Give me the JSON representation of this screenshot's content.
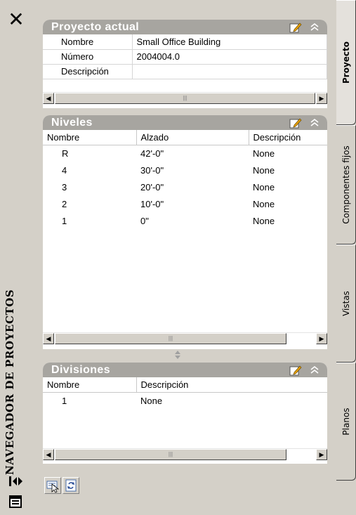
{
  "strip": {
    "title": "NAVEGADOR DE PROYECTOS",
    "close_icon": "close-icon",
    "auto_hide_icon": "auto-hide-icon",
    "properties_icon": "properties-icon"
  },
  "proyecto": {
    "title": "Proyecto actual",
    "rows": [
      {
        "label": "Nombre",
        "value": "Small Office Building"
      },
      {
        "label": "Número",
        "value": "2004004.0"
      },
      {
        "label": "Descripción",
        "value": ""
      }
    ]
  },
  "niveles": {
    "title": "Niveles",
    "columns": [
      "Nombre",
      "Alzado",
      "Descripción"
    ],
    "rows": [
      {
        "name": "R",
        "elev": "42'-0\"",
        "desc": "None"
      },
      {
        "name": "4",
        "elev": "30'-0\"",
        "desc": "None"
      },
      {
        "name": "3",
        "elev": "20'-0\"",
        "desc": "None"
      },
      {
        "name": "2",
        "elev": "10'-0\"",
        "desc": "None"
      },
      {
        "name": "1",
        "elev": "0\"",
        "desc": "None"
      }
    ]
  },
  "divisiones": {
    "title": "Divisiones",
    "columns": [
      "Nombre",
      "Descripción"
    ],
    "rows": [
      {
        "name": "1",
        "desc": "None"
      }
    ]
  },
  "tabs": [
    "Proyecto",
    "Componentes fijos",
    "Vistas",
    "Planos"
  ],
  "bottom_buttons": [
    "select-project-icon",
    "refresh-icon"
  ],
  "colors": {
    "panel_header": "#a7a5a0",
    "background": "#d4d0c8"
  }
}
